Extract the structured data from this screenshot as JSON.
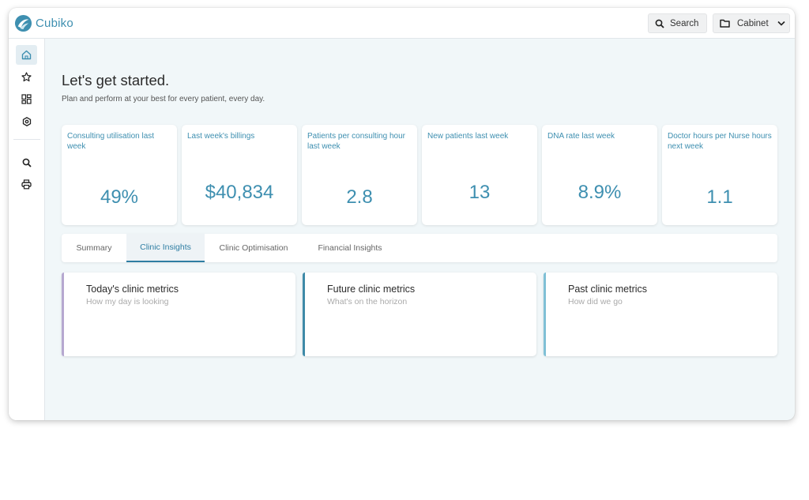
{
  "app": {
    "name": "Cubiko"
  },
  "header": {
    "search_label": "Search",
    "cabinet_label": "Cabinet"
  },
  "sidebar": {
    "items": [
      {
        "icon": "home-icon",
        "active": true
      },
      {
        "icon": "star-icon",
        "active": false
      },
      {
        "icon": "dashboard-icon",
        "active": false
      },
      {
        "icon": "settings-icon",
        "active": false
      },
      {
        "icon": "search-icon",
        "active": false
      },
      {
        "icon": "print-icon",
        "active": false
      }
    ]
  },
  "page": {
    "title": "Let's get started.",
    "subtitle": "Plan and perform at your best for every patient, every day."
  },
  "kpis": [
    {
      "label": "Consulting utilisation last week",
      "value": "49%"
    },
    {
      "label": "Last week's billings",
      "value": "$40,834"
    },
    {
      "label": "Patients per consulting hour last week",
      "value": "2.8"
    },
    {
      "label": "New patients last week",
      "value": "13"
    },
    {
      "label": "DNA rate last week",
      "value": "8.9%"
    },
    {
      "label": "Doctor hours per Nurse hours next week",
      "value": "1.1"
    }
  ],
  "tabs": [
    {
      "label": "Summary",
      "active": false
    },
    {
      "label": "Clinic Insights",
      "active": true
    },
    {
      "label": "Clinic Optimisation",
      "active": false
    },
    {
      "label": "Financial Insights",
      "active": false
    }
  ],
  "cards": [
    {
      "title": "Today's clinic metrics",
      "subtitle": "How my day is looking",
      "accent": "#b6a8d0"
    },
    {
      "title": "Future clinic metrics",
      "subtitle": "What's on the horizon",
      "accent": "#3e8aa8"
    },
    {
      "title": "Past clinic metrics",
      "subtitle": "How did we go",
      "accent": "#7fc0d6"
    }
  ],
  "colors": {
    "accent": "#3e8fb0",
    "background": "#f1f7f9",
    "active_tab": "#2f7ea3"
  }
}
